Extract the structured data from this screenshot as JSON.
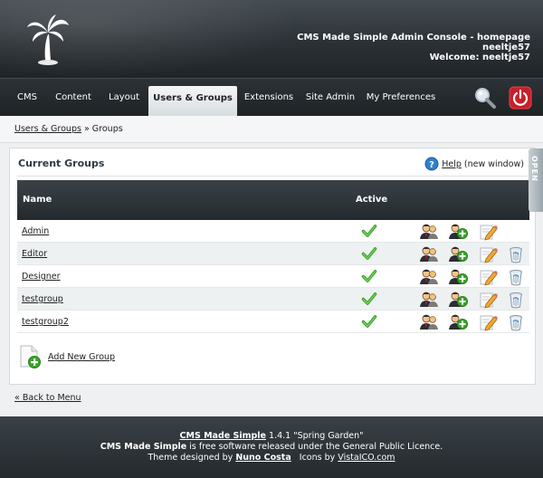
{
  "header": {
    "console_title": "CMS Made Simple Admin Console - homepage",
    "username": "neeltje57",
    "welcome": "Welcome: neeltje57"
  },
  "nav": {
    "items": [
      {
        "label": "CMS"
      },
      {
        "label": "Content"
      },
      {
        "label": "Layout"
      },
      {
        "label": "Users & Groups",
        "active": true
      },
      {
        "label": "Extensions"
      },
      {
        "label": "Site Admin"
      },
      {
        "label": "My Preferences"
      }
    ],
    "search_icon": "magnifier-icon",
    "logout_icon": "power-icon"
  },
  "breadcrumb": {
    "link": "Users & Groups",
    "separator": "»",
    "current": "Groups"
  },
  "panel": {
    "title": "Current Groups",
    "help_link": "Help",
    "help_suffix": "(new window)",
    "open_tab": "OPEN"
  },
  "table": {
    "headers": {
      "name": "Name",
      "active": "Active"
    },
    "rows": [
      {
        "name": "Admin",
        "active": true,
        "deletable": false
      },
      {
        "name": "Editor",
        "active": true,
        "deletable": true
      },
      {
        "name": "Designer",
        "active": true,
        "deletable": true
      },
      {
        "name": "testgroup",
        "active": true,
        "deletable": true
      },
      {
        "name": "testgroup2",
        "active": true,
        "deletable": true
      }
    ]
  },
  "actions": {
    "add_group": "Add New Group",
    "back": "« Back to Menu"
  },
  "footer": {
    "cms_name": "CMS Made Simple",
    "version": "1.4.1 \"Spring Garden\"",
    "licence_brand": "CMS Made Simple",
    "licence_text": "is free software released under the General Public Licence.",
    "theme_prefix": "Theme designed by",
    "theme_author": "Nuno Costa",
    "icons_prefix": "Icons by",
    "icons_author": "VistaICO.com"
  },
  "colors": {
    "header_bg": "#2b3136",
    "active_tab": "#e4e9ec",
    "check_green": "#3aa52a",
    "logout_red": "#c8202a"
  }
}
